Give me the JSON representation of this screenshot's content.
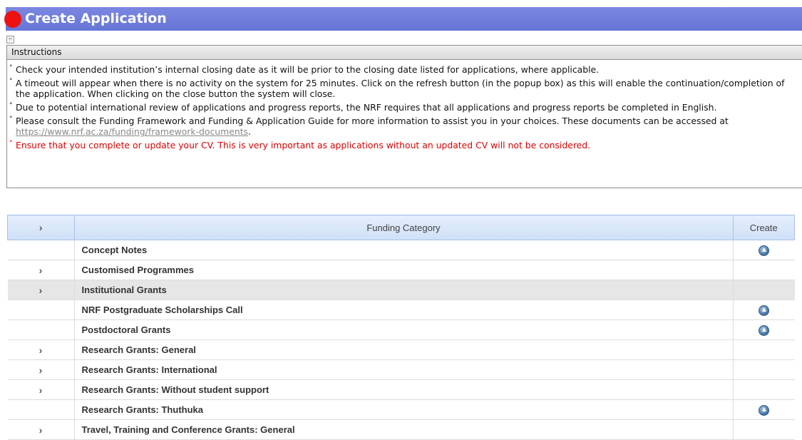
{
  "header": {
    "title": "Create Application"
  },
  "collapse_symbol": "−",
  "instructions": {
    "title": "Instructions",
    "items": [
      "Check your intended institution’s internal closing date as it will be prior to the closing date listed for applications, where applicable.",
      "A timeout will appear when there is no activity on the system for 25 minutes. Click on the refresh button (in the popup box) as this will enable the continuation/completion of the application. When clicking on the close button the system will close.",
      "Due to potential international review of applications and progress reports, the NRF requires that all applications and progress reports be completed in English.",
      "Ensure that you complete or update your CV. This is very important as applications without an updated CV will not be considered."
    ],
    "consult_text": "Please consult the Funding Framework and Funding & Application Guide for more information to assist you in your choices. These documents can be accessed at ",
    "consult_link": "https://www.nrf.ac.za/funding/framework-documents",
    "consult_tail": "."
  },
  "table": {
    "headers": {
      "expand": "›",
      "category": "Funding Category",
      "create": "Create"
    },
    "chevron": "›",
    "rows": [
      {
        "name": "Concept Notes",
        "expandable": false,
        "creatable": true
      },
      {
        "name": "Customised Programmes",
        "expandable": true,
        "creatable": false
      },
      {
        "name": "Institutional Grants",
        "expandable": true,
        "creatable": false
      },
      {
        "name": "NRF Postgraduate Scholarships Call",
        "expandable": false,
        "creatable": true
      },
      {
        "name": "Postdoctoral Grants",
        "expandable": false,
        "creatable": true
      },
      {
        "name": "Research Grants: General",
        "expandable": true,
        "creatable": false
      },
      {
        "name": "Research Grants: International",
        "expandable": true,
        "creatable": false
      },
      {
        "name": "Research Grants: Without student support",
        "expandable": true,
        "creatable": false
      },
      {
        "name": "Research Grants: Thuthuka",
        "expandable": false,
        "creatable": true
      },
      {
        "name": "Travel, Training and Conference Grants: General",
        "expandable": true,
        "creatable": false
      }
    ]
  },
  "colors": {
    "header_bg": "#6775d6",
    "title_dot": "#ee1111",
    "warning_text": "#e00000",
    "link_text": "#888888"
  }
}
